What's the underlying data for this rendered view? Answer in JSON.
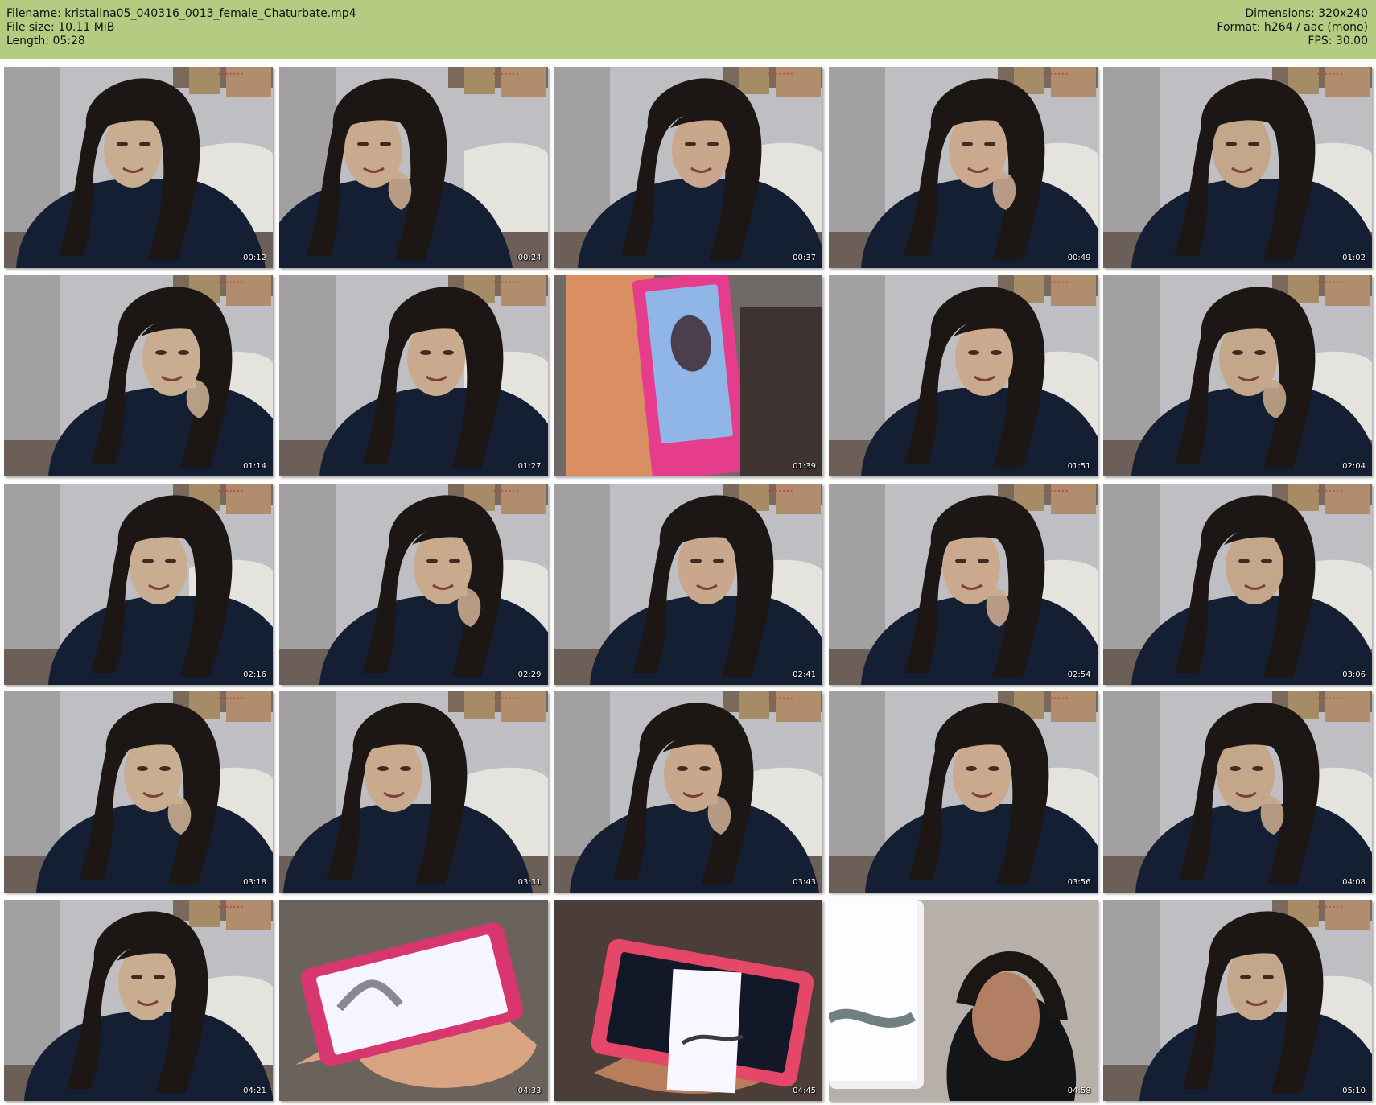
{
  "header": {
    "filename": "Filename: kristalina05_040316_0013_female_Chaturbate.mp4",
    "file_size": "File size: 10.11 MiB",
    "length": "Length: 05:28",
    "dimensions": "Dimensions: 320x240",
    "format": "Format: h264 / aac (mono)",
    "fps": "FPS: 30.00"
  },
  "colors": {
    "header_background": "#b3cc82",
    "page_background": "#ffffff",
    "timestamp_text": "#ffffff"
  },
  "frames": [
    {
      "time": "00:12",
      "scene": "person"
    },
    {
      "time": "00:24",
      "scene": "person"
    },
    {
      "time": "00:37",
      "scene": "person"
    },
    {
      "time": "00:49",
      "scene": "person"
    },
    {
      "time": "01:02",
      "scene": "person"
    },
    {
      "time": "01:14",
      "scene": "person"
    },
    {
      "time": "01:27",
      "scene": "person"
    },
    {
      "time": "01:39",
      "scene": "phone"
    },
    {
      "time": "01:51",
      "scene": "person"
    },
    {
      "time": "02:04",
      "scene": "person"
    },
    {
      "time": "02:16",
      "scene": "person"
    },
    {
      "time": "02:29",
      "scene": "person"
    },
    {
      "time": "02:41",
      "scene": "person"
    },
    {
      "time": "02:54",
      "scene": "person"
    },
    {
      "time": "03:06",
      "scene": "person"
    },
    {
      "time": "03:18",
      "scene": "person"
    },
    {
      "time": "03:31",
      "scene": "person"
    },
    {
      "time": "03:43",
      "scene": "person"
    },
    {
      "time": "03:56",
      "scene": "person"
    },
    {
      "time": "04:08",
      "scene": "person"
    },
    {
      "time": "04:21",
      "scene": "person"
    },
    {
      "time": "04:33",
      "scene": "phone"
    },
    {
      "time": "04:45",
      "scene": "phone"
    },
    {
      "time": "04:58",
      "scene": "phone"
    },
    {
      "time": "05:10",
      "scene": "person"
    }
  ]
}
